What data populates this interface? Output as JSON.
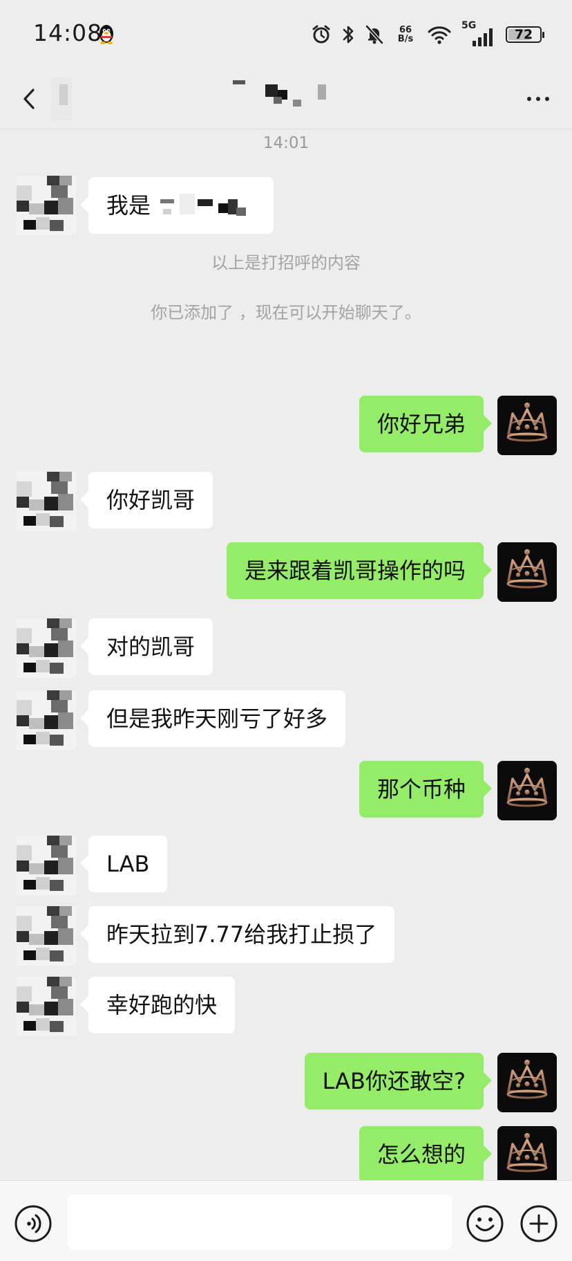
{
  "status_bar": {
    "time": "14:08",
    "net_speed_value": "66",
    "net_speed_unit": "B/s",
    "signal_label": "5G",
    "battery": "72",
    "battery_level": 0.72
  },
  "header": {
    "contact_name_pixelated": true
  },
  "chat": {
    "timestamp": "14:01",
    "greeting_note": "以上是打招呼的内容",
    "added_note": "你已添加了 ，现在可以开始聊天了。",
    "messages": [
      {
        "side": "in",
        "text": "我是"
      },
      {
        "side": "out",
        "text": "你好兄弟"
      },
      {
        "side": "in",
        "text": "你好凯哥"
      },
      {
        "side": "out",
        "text": "是来跟着凯哥操作的吗"
      },
      {
        "side": "in",
        "text": "对的凯哥"
      },
      {
        "side": "in",
        "text": "但是我昨天刚亏了好多"
      },
      {
        "side": "out",
        "text": "那个币种"
      },
      {
        "side": "in",
        "text": "LAB"
      },
      {
        "side": "in",
        "text": "昨天拉到7.77给我打止损了"
      },
      {
        "side": "in",
        "text": "幸好跑的快"
      },
      {
        "side": "out",
        "text": "LAB你还敢空?"
      },
      {
        "side": "out",
        "text": "怎么想的"
      }
    ]
  },
  "input_bar": {
    "value": "",
    "placeholder": ""
  },
  "colors": {
    "background": "#ededed",
    "bubble_out": "#95ec69",
    "bubble_in": "#ffffff",
    "input_bar": "#f7f7f7"
  },
  "icons": [
    "qq-penguin-icon",
    "alarm-icon",
    "bluetooth-icon",
    "mute-bell-icon",
    "wifi-icon",
    "signal-icon",
    "battery-icon",
    "back-icon",
    "more-icon",
    "voice-icon",
    "emoji-icon",
    "plus-icon",
    "crown-avatar"
  ]
}
